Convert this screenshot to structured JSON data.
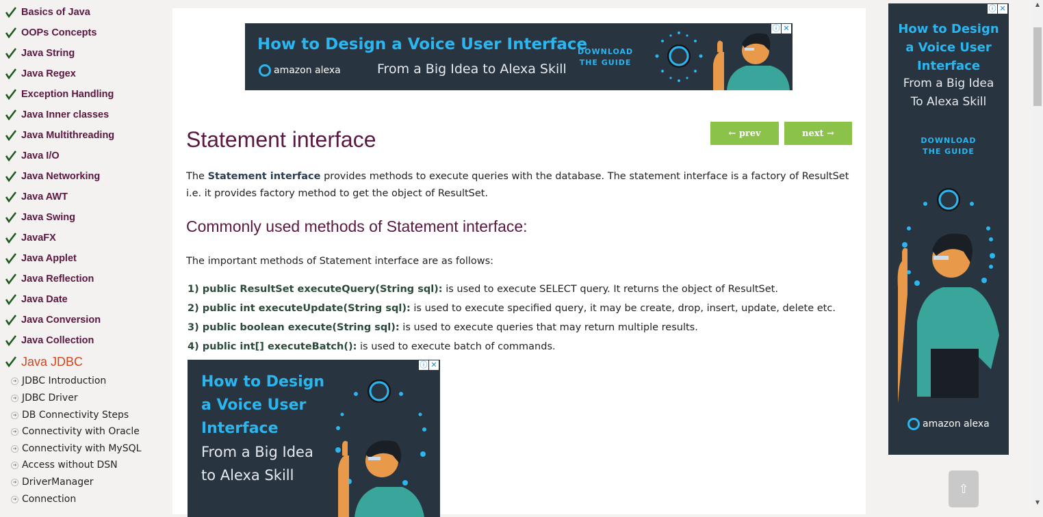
{
  "sidebar": {
    "items": [
      {
        "label": "Basics of Java"
      },
      {
        "label": "OOPs Concepts"
      },
      {
        "label": "Java String"
      },
      {
        "label": "Java Regex"
      },
      {
        "label": "Exception Handling"
      },
      {
        "label": "Java Inner classes"
      },
      {
        "label": "Java Multithreading"
      },
      {
        "label": "Java I/O"
      },
      {
        "label": "Java Networking"
      },
      {
        "label": "Java AWT"
      },
      {
        "label": "Java Swing"
      },
      {
        "label": "JavaFX"
      },
      {
        "label": "Java Applet"
      },
      {
        "label": "Java Reflection"
      },
      {
        "label": "Java Date"
      },
      {
        "label": "Java Conversion"
      },
      {
        "label": "Java Collection"
      },
      {
        "label": "Java JDBC"
      }
    ],
    "subitems": [
      {
        "label": "JDBC Introduction"
      },
      {
        "label": "JDBC Driver"
      },
      {
        "label": "DB Connectivity Steps"
      },
      {
        "label": "Connectivity with Oracle"
      },
      {
        "label": "Connectivity with MySQL"
      },
      {
        "label": "Access without DSN"
      },
      {
        "label": "DriverManager"
      },
      {
        "label": "Connection"
      }
    ]
  },
  "ad_banner": {
    "title": "How to Design a Voice User Interface",
    "brand": "amazon alexa",
    "subtitle": "From a Big Idea to Alexa Skill",
    "cta_line1": "DOWNLOAD",
    "cta_line2": "THE GUIDE",
    "info": "ⓘ",
    "close": "✕"
  },
  "page": {
    "title": "Statement interface",
    "prev_label": "← prev",
    "next_label": "next →",
    "intro_pre": "The ",
    "intro_bold": "Statement interface",
    "intro_post": " provides methods to execute queries with the database. The statement interface is a factory of ResultSet i.e. it provides factory method to get the object of ResultSet.",
    "subheading": "Commonly used methods of Statement interface:",
    "methods_intro": "The important methods of Statement interface are as follows:",
    "methods": [
      {
        "sig": "1) public ResultSet executeQuery(String sql):",
        "desc": " is used to execute SELECT query. It returns the object of ResultSet."
      },
      {
        "sig": "2) public int executeUpdate(String sql):",
        "desc": " is used to execute specified query, it may be create, drop, insert, update, delete etc."
      },
      {
        "sig": "3) public boolean execute(String sql):",
        "desc": " is used to execute queries that may return multiple results."
      },
      {
        "sig": "4) public int[] executeBatch():",
        "desc": " is used to execute batch of commands."
      }
    ]
  },
  "ad_box": {
    "title_l1": "How to Design",
    "title_l2": "a Voice User",
    "title_l3": "Interface",
    "sub_l1": "From a Big Idea",
    "sub_l2": "to Alexa Skill",
    "info": "ⓘ",
    "close": "✕"
  },
  "ad_side": {
    "title_l1": "How to Design",
    "title_l2": "a Voice User",
    "title_l3": "Interface",
    "sub_l1": "From a Big Idea",
    "sub_l2": "To Alexa Skill",
    "cta_line1": "DOWNLOAD",
    "cta_line2": "THE GUIDE",
    "brand": "amazon alexa",
    "info": "ⓘ",
    "close": "✕"
  },
  "controls": {
    "scroll_top": "⇧",
    "scroll_up": "▲",
    "scroll_down": "▼"
  },
  "icons": {
    "check": "check-icon",
    "bullet": "circle-arrow-icon"
  }
}
